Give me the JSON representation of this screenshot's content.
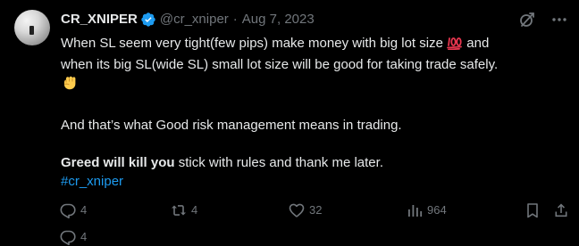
{
  "tweet": {
    "author": {
      "display_name": "CR_XNIPER",
      "handle": "@cr_xniper",
      "verified": true
    },
    "separator": "·",
    "date": "Aug 7, 2023",
    "text": {
      "line1": "When SL seem very tight(few pips) make money with big lot size",
      "line1_emoji": "💯",
      "line1_end": "and",
      "line2": "when its big SL(wide SL) small lot size will be good for taking trade safely.",
      "line3_emoji": "✊",
      "para2": "And that’s what Good risk management means in trading.",
      "para3_bold": "Greed will kill you",
      "para3_rest": " stick with rules and thank me later.",
      "hashtag": "#cr_xniper"
    },
    "actions": {
      "replies": "4",
      "reposts": "4",
      "likes": "32",
      "views": "964"
    }
  },
  "colors": {
    "background": "#000000",
    "text": "#e7e9ea",
    "muted": "#71767b",
    "accent": "#1d9bf0"
  },
  "icons": {
    "verified": "verified-badge-icon",
    "grok": "grok-icon",
    "more": "more-icon",
    "reply": "reply-icon",
    "repost": "repost-icon",
    "like": "heart-icon",
    "views": "views-icon",
    "bookmark": "bookmark-icon",
    "share": "share-icon"
  }
}
